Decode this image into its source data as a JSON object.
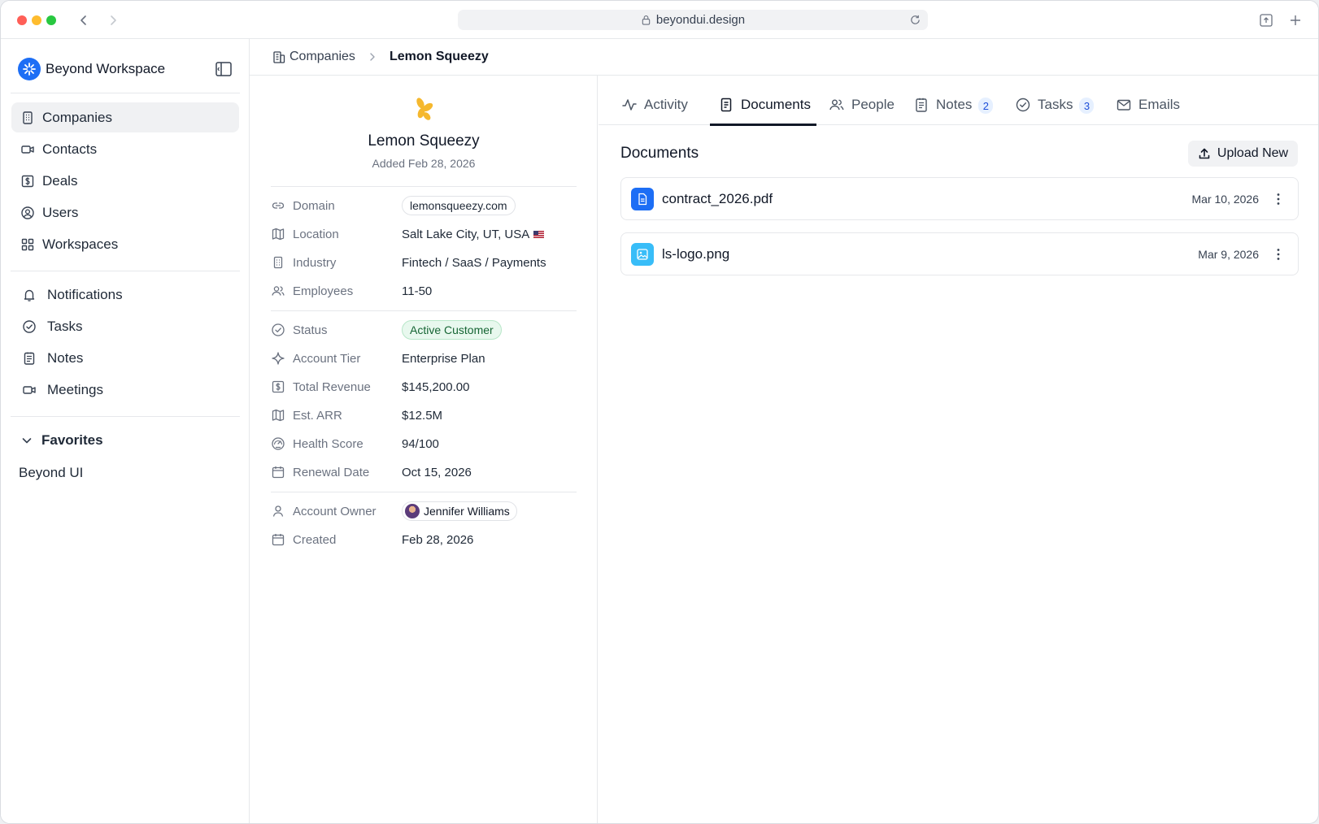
{
  "browser": {
    "url": "beyondui.design"
  },
  "sidebar": {
    "workspace_name": "Beyond Workspace",
    "primary_items": [
      {
        "label": "Companies",
        "icon": "building-icon"
      },
      {
        "label": "Contacts",
        "icon": "video-icon"
      },
      {
        "label": "Deals",
        "icon": "dollar-icon"
      },
      {
        "label": "Users",
        "icon": "user-circle-icon"
      },
      {
        "label": "Workspaces",
        "icon": "grid-icon"
      }
    ],
    "secondary_items": [
      {
        "label": "Notifications",
        "icon": "bell-icon"
      },
      {
        "label": "Tasks",
        "icon": "check-circle-icon"
      },
      {
        "label": "Notes",
        "icon": "notes-icon"
      },
      {
        "label": "Meetings",
        "icon": "video-icon"
      }
    ],
    "favorites_label": "Favorites",
    "favorites": [
      "Beyond UI"
    ]
  },
  "breadcrumb": {
    "parent": "Companies",
    "current": "Lemon Squeezy"
  },
  "company": {
    "name": "Lemon Squeezy",
    "added": "Added Feb 28, 2026",
    "properties_group1": [
      {
        "label": "Domain",
        "value": "lemonsqueezy.com"
      },
      {
        "label": "Location",
        "value": "Salt Lake City, UT, USA"
      },
      {
        "label": "Industry",
        "value": "Fintech / SaaS / Payments"
      },
      {
        "label": "Employees",
        "value": "11-50"
      }
    ],
    "properties_group2": [
      {
        "label": "Status",
        "value": "Active Customer"
      },
      {
        "label": "Account Tier",
        "value": "Enterprise Plan"
      },
      {
        "label": "Total Revenue",
        "value": "$145,200.00"
      },
      {
        "label": "Est. ARR",
        "value": "$12.5M"
      },
      {
        "label": "Health Score",
        "value": "94/100"
      },
      {
        "label": "Renewal Date",
        "value": "Oct 15, 2026"
      }
    ],
    "properties_group3": [
      {
        "label": "Account Owner",
        "value": "Jennifer Williams"
      },
      {
        "label": "Created",
        "value": "Feb 28, 2026"
      }
    ]
  },
  "tabs": [
    {
      "label": "Activity",
      "badge": null
    },
    {
      "label": "Documents",
      "badge": null
    },
    {
      "label": "People",
      "badge": null
    },
    {
      "label": "Notes",
      "badge": "2"
    },
    {
      "label": "Tasks",
      "badge": "3"
    },
    {
      "label": "Emails",
      "badge": null
    }
  ],
  "active_tab": "Documents",
  "documents": {
    "title": "Documents",
    "upload_label": "Upload New",
    "items": [
      {
        "name": "contract_2026.pdf",
        "date": "Mar 10, 2026",
        "icon": "document-icon",
        "color": "#1d6ef5"
      },
      {
        "name": "ls-logo.png",
        "date": "Mar 9, 2026",
        "icon": "image-icon",
        "color": "#38bdf8"
      }
    ]
  },
  "colors": {
    "accent": "#1d6ef5",
    "status_green": "#166534",
    "badge_blue": "#1d4ed8",
    "lemon": "#f5b82e"
  }
}
